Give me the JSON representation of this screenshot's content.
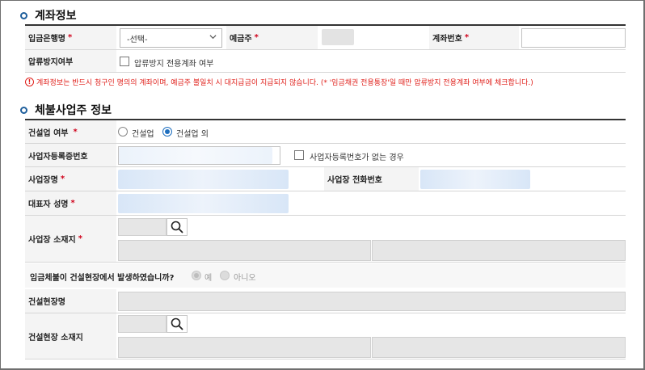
{
  "account_section": {
    "title": "계좌정보",
    "bank_label": "입금은행명",
    "bank_select_value": "-선택-",
    "depositor_label": "예금주",
    "account_number_label": "계좌번호",
    "seizure_label": "압류방지여부",
    "seizure_checkbox_label": "압류방지 전용계좌 여부",
    "notice": "계좌정보는 반드시 청구인 명의의 계좌이며, 예금주 불일치 시 대지급금이 지급되지 않습니다. (* '임금채권 전용통장'일 때만 압류방지 전용계좌 여부에 체크합니다.)",
    "required_mark": "*"
  },
  "employer_section": {
    "title": "체불사업주 정보",
    "construction_label": "건설업 여부",
    "construction_options": [
      "건설업",
      "건설업 외"
    ],
    "construction_selected": "건설업 외",
    "business_reg_label": "사업자등록증번호",
    "no_business_reg_checkbox_label": "사업자등록번호가 없는 경우",
    "workplace_name_label": "사업장명",
    "workplace_phone_label": "사업장 전화번호",
    "representative_label": "대표자 성명",
    "workplace_address_label": "사업장 소재지",
    "site_question": "임금체불이 건설현장에서 발생하였습니까?",
    "site_question_options": [
      "예",
      "아니오"
    ],
    "site_name_label": "건설현장명",
    "site_address_label": "건설현장 소재지",
    "required_mark": "*"
  },
  "colors": {
    "required": "#d0021b",
    "notice": "#e0201b",
    "accent": "#1e6fbf",
    "label_bg": "#f4f4f4"
  },
  "icons": [
    "chevron-down-icon",
    "search-icon",
    "alert-circle-icon",
    "section-bullet-icon"
  ]
}
